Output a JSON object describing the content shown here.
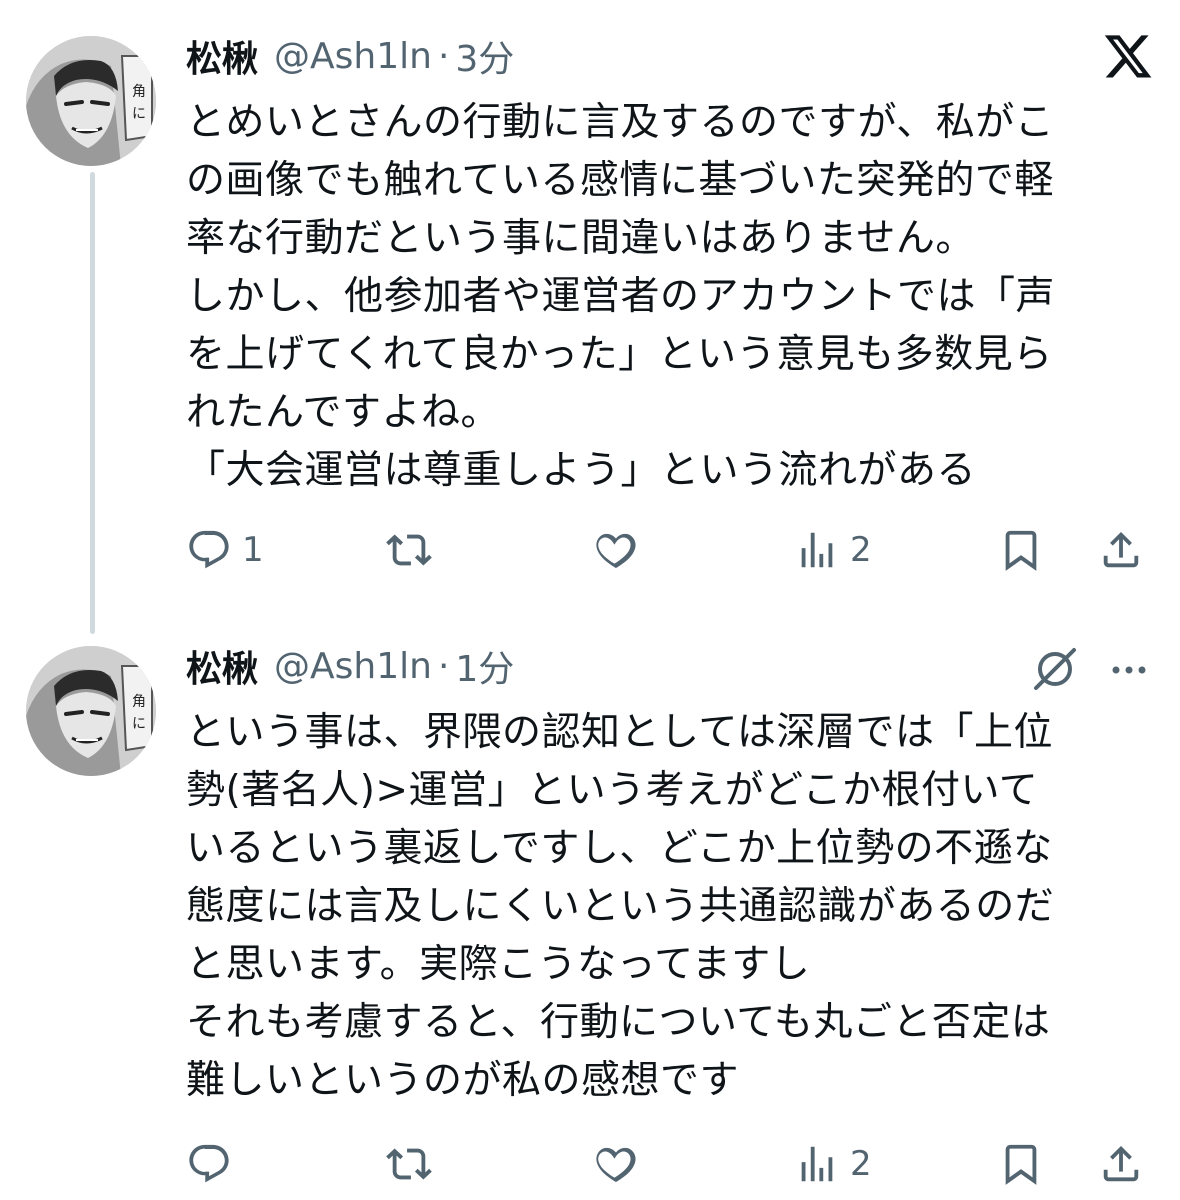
{
  "tweets": [
    {
      "author_name": "松楸",
      "handle": "@Ash1ln",
      "separator": "·",
      "time": "3分",
      "lines": [
        "とめいとさんの行動に言及するのですが、私がこ",
        "の画像でも触れている感情に基づいた突発的で軽",
        "率な行動だという事に間違いはありません。",
        "しかし、他参加者や運営者のアカウントでは「声",
        "を上げてくれて良かった」という意見も多数見ら",
        "れたんですよね。",
        "「大会運営は尊重しよう」という流れがある"
      ],
      "actions": {
        "replies": "1",
        "retweets": "",
        "likes": "",
        "views": "2"
      }
    },
    {
      "author_name": "松楸",
      "handle": "@Ash1ln",
      "separator": "·",
      "time": "1分",
      "lines": [
        "という事は、界隈の認知としては深層では「上位",
        "勢(著名人)>運営」という考えがどこか根付いて",
        "いるという裏返しですし、どこか上位勢の不遜な",
        "態度には言及しにくいという共通認識があるのだ",
        "と思います。実際こうなってますし",
        "それも考慮すると、行動についても丸ごと否定は",
        "難しいというのが私の感想です"
      ],
      "actions": {
        "replies": "",
        "retweets": "",
        "likes": "",
        "views": "2"
      }
    }
  ],
  "icons": {
    "brand": "x-logo-icon",
    "reply": "speech-bubble-icon",
    "retweet": "retweet-arrows-icon",
    "like": "heart-icon",
    "views": "bar-chart-icon",
    "bookmark": "bookmark-icon",
    "share": "share-upload-icon",
    "grok": "grok-slash-icon",
    "more": "ellipsis-icon"
  },
  "colors": {
    "text": "#0f1419",
    "secondary": "#536471",
    "thread_line": "#cfd9de"
  }
}
